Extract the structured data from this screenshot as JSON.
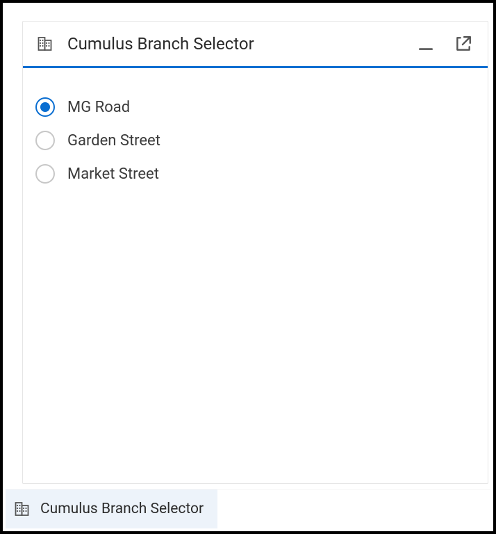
{
  "window": {
    "title": "Cumulus Branch Selector"
  },
  "branches": {
    "items": [
      {
        "label": "MG Road",
        "selected": true
      },
      {
        "label": "Garden Street",
        "selected": false
      },
      {
        "label": "Market Street",
        "selected": false
      }
    ]
  },
  "taskbar": {
    "items": [
      {
        "label": "Cumulus Branch Selector"
      }
    ]
  },
  "colors": {
    "accent": "#0a6ed1"
  }
}
